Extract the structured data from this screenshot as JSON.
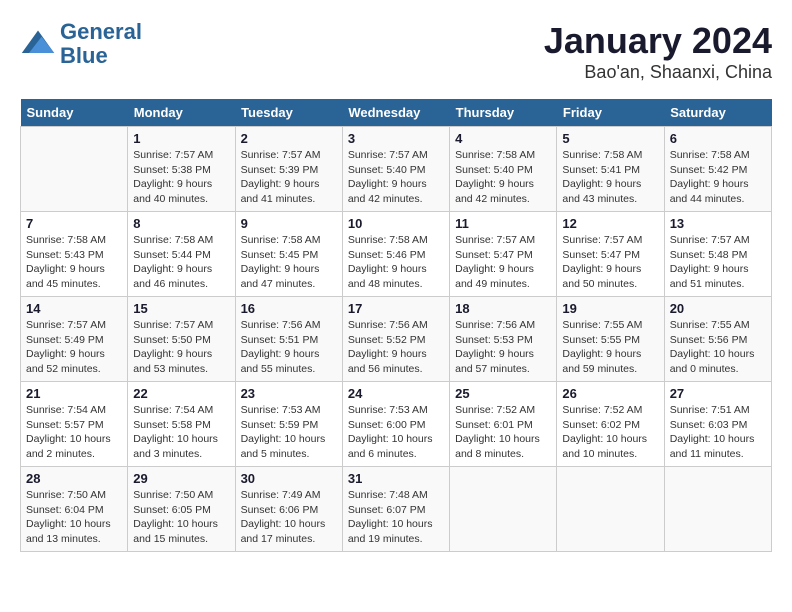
{
  "header": {
    "logo_line1": "General",
    "logo_line2": "Blue",
    "title": "January 2024",
    "subtitle": "Bao'an, Shaanxi, China"
  },
  "days_of_week": [
    "Sunday",
    "Monday",
    "Tuesday",
    "Wednesday",
    "Thursday",
    "Friday",
    "Saturday"
  ],
  "weeks": [
    [
      {
        "day": "",
        "content": ""
      },
      {
        "day": "1",
        "content": "Sunrise: 7:57 AM\nSunset: 5:38 PM\nDaylight: 9 hours\nand 40 minutes."
      },
      {
        "day": "2",
        "content": "Sunrise: 7:57 AM\nSunset: 5:39 PM\nDaylight: 9 hours\nand 41 minutes."
      },
      {
        "day": "3",
        "content": "Sunrise: 7:57 AM\nSunset: 5:40 PM\nDaylight: 9 hours\nand 42 minutes."
      },
      {
        "day": "4",
        "content": "Sunrise: 7:58 AM\nSunset: 5:40 PM\nDaylight: 9 hours\nand 42 minutes."
      },
      {
        "day": "5",
        "content": "Sunrise: 7:58 AM\nSunset: 5:41 PM\nDaylight: 9 hours\nand 43 minutes."
      },
      {
        "day": "6",
        "content": "Sunrise: 7:58 AM\nSunset: 5:42 PM\nDaylight: 9 hours\nand 44 minutes."
      }
    ],
    [
      {
        "day": "7",
        "content": "Sunrise: 7:58 AM\nSunset: 5:43 PM\nDaylight: 9 hours\nand 45 minutes."
      },
      {
        "day": "8",
        "content": "Sunrise: 7:58 AM\nSunset: 5:44 PM\nDaylight: 9 hours\nand 46 minutes."
      },
      {
        "day": "9",
        "content": "Sunrise: 7:58 AM\nSunset: 5:45 PM\nDaylight: 9 hours\nand 47 minutes."
      },
      {
        "day": "10",
        "content": "Sunrise: 7:58 AM\nSunset: 5:46 PM\nDaylight: 9 hours\nand 48 minutes."
      },
      {
        "day": "11",
        "content": "Sunrise: 7:57 AM\nSunset: 5:47 PM\nDaylight: 9 hours\nand 49 minutes."
      },
      {
        "day": "12",
        "content": "Sunrise: 7:57 AM\nSunset: 5:47 PM\nDaylight: 9 hours\nand 50 minutes."
      },
      {
        "day": "13",
        "content": "Sunrise: 7:57 AM\nSunset: 5:48 PM\nDaylight: 9 hours\nand 51 minutes."
      }
    ],
    [
      {
        "day": "14",
        "content": "Sunrise: 7:57 AM\nSunset: 5:49 PM\nDaylight: 9 hours\nand 52 minutes."
      },
      {
        "day": "15",
        "content": "Sunrise: 7:57 AM\nSunset: 5:50 PM\nDaylight: 9 hours\nand 53 minutes."
      },
      {
        "day": "16",
        "content": "Sunrise: 7:56 AM\nSunset: 5:51 PM\nDaylight: 9 hours\nand 55 minutes."
      },
      {
        "day": "17",
        "content": "Sunrise: 7:56 AM\nSunset: 5:52 PM\nDaylight: 9 hours\nand 56 minutes."
      },
      {
        "day": "18",
        "content": "Sunrise: 7:56 AM\nSunset: 5:53 PM\nDaylight: 9 hours\nand 57 minutes."
      },
      {
        "day": "19",
        "content": "Sunrise: 7:55 AM\nSunset: 5:55 PM\nDaylight: 9 hours\nand 59 minutes."
      },
      {
        "day": "20",
        "content": "Sunrise: 7:55 AM\nSunset: 5:56 PM\nDaylight: 10 hours\nand 0 minutes."
      }
    ],
    [
      {
        "day": "21",
        "content": "Sunrise: 7:54 AM\nSunset: 5:57 PM\nDaylight: 10 hours\nand 2 minutes."
      },
      {
        "day": "22",
        "content": "Sunrise: 7:54 AM\nSunset: 5:58 PM\nDaylight: 10 hours\nand 3 minutes."
      },
      {
        "day": "23",
        "content": "Sunrise: 7:53 AM\nSunset: 5:59 PM\nDaylight: 10 hours\nand 5 minutes."
      },
      {
        "day": "24",
        "content": "Sunrise: 7:53 AM\nSunset: 6:00 PM\nDaylight: 10 hours\nand 6 minutes."
      },
      {
        "day": "25",
        "content": "Sunrise: 7:52 AM\nSunset: 6:01 PM\nDaylight: 10 hours\nand 8 minutes."
      },
      {
        "day": "26",
        "content": "Sunrise: 7:52 AM\nSunset: 6:02 PM\nDaylight: 10 hours\nand 10 minutes."
      },
      {
        "day": "27",
        "content": "Sunrise: 7:51 AM\nSunset: 6:03 PM\nDaylight: 10 hours\nand 11 minutes."
      }
    ],
    [
      {
        "day": "28",
        "content": "Sunrise: 7:50 AM\nSunset: 6:04 PM\nDaylight: 10 hours\nand 13 minutes."
      },
      {
        "day": "29",
        "content": "Sunrise: 7:50 AM\nSunset: 6:05 PM\nDaylight: 10 hours\nand 15 minutes."
      },
      {
        "day": "30",
        "content": "Sunrise: 7:49 AM\nSunset: 6:06 PM\nDaylight: 10 hours\nand 17 minutes."
      },
      {
        "day": "31",
        "content": "Sunrise: 7:48 AM\nSunset: 6:07 PM\nDaylight: 10 hours\nand 19 minutes."
      },
      {
        "day": "",
        "content": ""
      },
      {
        "day": "",
        "content": ""
      },
      {
        "day": "",
        "content": ""
      }
    ]
  ]
}
